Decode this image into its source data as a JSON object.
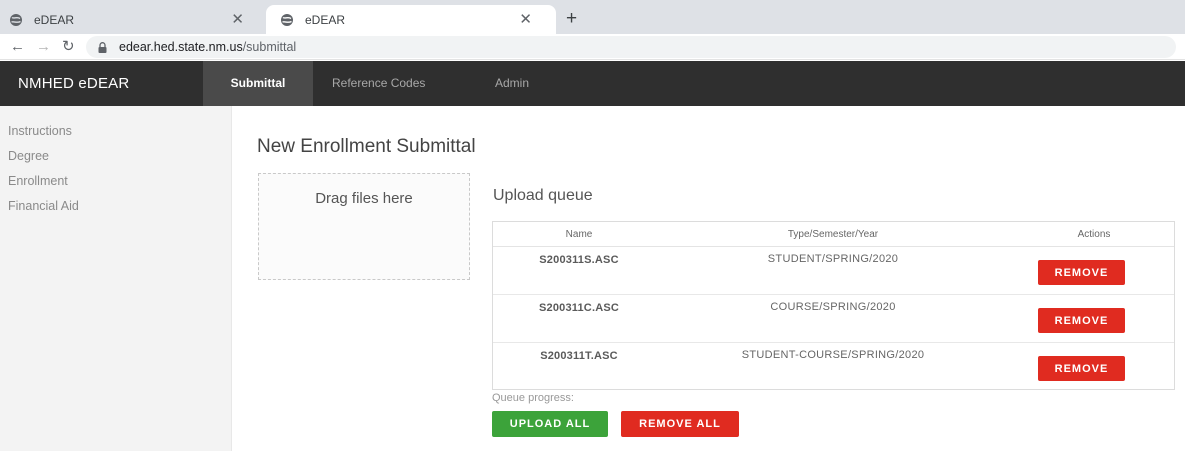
{
  "browser": {
    "tabs": [
      {
        "title": "eDEAR",
        "icon": "globe-icon",
        "active": false
      },
      {
        "title": "eDEAR",
        "icon": "globe-icon",
        "active": true
      }
    ],
    "new_tab_icon": "plus-icon",
    "url_host": "edear.hed.state.nm.us",
    "url_path": "/submittal"
  },
  "app": {
    "brand": "NMHED eDEAR",
    "nav": [
      {
        "label": "Submittal",
        "active": true
      },
      {
        "label": "Reference Codes",
        "active": false
      },
      {
        "label": "Admin",
        "active": false
      }
    ],
    "nav_bg_color": "#2f2f2f"
  },
  "sidebar": {
    "items": [
      {
        "label": "Instructions"
      },
      {
        "label": "Degree"
      },
      {
        "label": "Enrollment"
      },
      {
        "label": "Financial Aid"
      }
    ]
  },
  "main": {
    "title": "New Enrollment Submittal",
    "dropzone_label": "Drag files here",
    "queue_title": "Upload queue",
    "table": {
      "headers": {
        "name": "Name",
        "type": "Type/Semester/Year",
        "actions": "Actions"
      },
      "rows": [
        {
          "name": "S200311S.ASC",
          "type": "STUDENT/SPRING/2020",
          "action_label": "REMOVE"
        },
        {
          "name": "S200311C.ASC",
          "type": "COURSE/SPRING/2020",
          "action_label": "REMOVE"
        },
        {
          "name": "S200311T.ASC",
          "type": "STUDENT-COURSE/SPRING/2020",
          "action_label": "REMOVE"
        }
      ]
    },
    "queue_progress_label": "Queue progress:",
    "upload_all_label": "UPLOAD ALL",
    "remove_all_label": "REMOVE ALL",
    "colors": {
      "danger": "#e02b20",
      "success": "#3ca33a"
    }
  }
}
